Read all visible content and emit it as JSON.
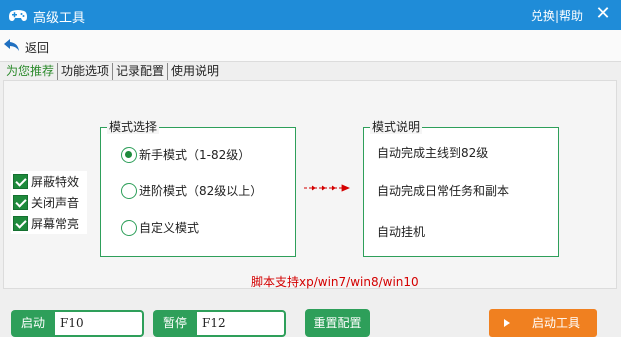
{
  "window": {
    "title": "高级工具",
    "menu_switch": "兑换",
    "menu_separator": "|",
    "menu_help": "帮助",
    "close_glyph": "✕",
    "logo_icon": "gamepad-icon"
  },
  "nav": {
    "back_label": "返回",
    "back_icon": "back-arrow-icon"
  },
  "tabs": [
    {
      "label": "为您推荐",
      "active": true
    },
    {
      "label": "功能选项",
      "active": false
    },
    {
      "label": "记录配置",
      "active": false
    },
    {
      "label": "使用说明",
      "active": false
    }
  ],
  "options": [
    {
      "label": "屏蔽特效",
      "checked": true
    },
    {
      "label": "关闭声音",
      "checked": true
    },
    {
      "label": "屏幕常亮",
      "checked": true
    }
  ],
  "mode_group": {
    "title": "模式选择",
    "modes": [
      {
        "label": "新手模式（1-82级）",
        "selected": true
      },
      {
        "label": "进阶模式（82级以上）",
        "selected": false
      },
      {
        "label": "自定义模式",
        "selected": false
      }
    ]
  },
  "desc_group": {
    "title": "模式说明",
    "lines": [
      "自动完成主线到82级",
      "自动完成日常任务和副本",
      "自动挂机"
    ]
  },
  "support_note": "脚本支持xp/win7/win8/win10",
  "hotkeys": {
    "start_label": "启动",
    "start_key": "F10",
    "pause_label": "暂停",
    "pause_key": "F12"
  },
  "buttons": {
    "reset": "重置配置",
    "launch": "启动工具"
  },
  "colors": {
    "titlebar": "#1f8cd8",
    "accent_green": "#2e9f5a",
    "launch_orange": "#f08020",
    "note_red": "#d40000"
  }
}
